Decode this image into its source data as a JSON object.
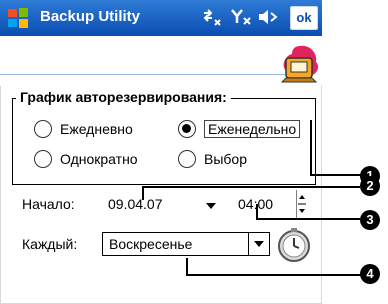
{
  "window": {
    "title": "Backup Utility",
    "ok_label": "ok",
    "start_icon": "windows-flag-icon",
    "status_icons": [
      "connectivity-icon",
      "signal-icon",
      "volume-icon"
    ]
  },
  "schedule_group": {
    "title": "График авторезервирования:",
    "options": [
      {
        "label": "Ежедневно",
        "checked": false
      },
      {
        "label": "Еженедельно",
        "checked": true
      },
      {
        "label": "Однократно",
        "checked": false
      },
      {
        "label": "Выбор",
        "checked": false
      }
    ]
  },
  "start": {
    "label": "Начало:",
    "date": "09.04.07",
    "time": "04:00"
  },
  "every": {
    "label": "Каждый:",
    "value": "Воскресенье"
  },
  "callouts": [
    "1",
    "2",
    "3",
    "4"
  ],
  "colors": {
    "titlebar": "#0b4db1",
    "accent_rule": "#9cb4e0"
  }
}
